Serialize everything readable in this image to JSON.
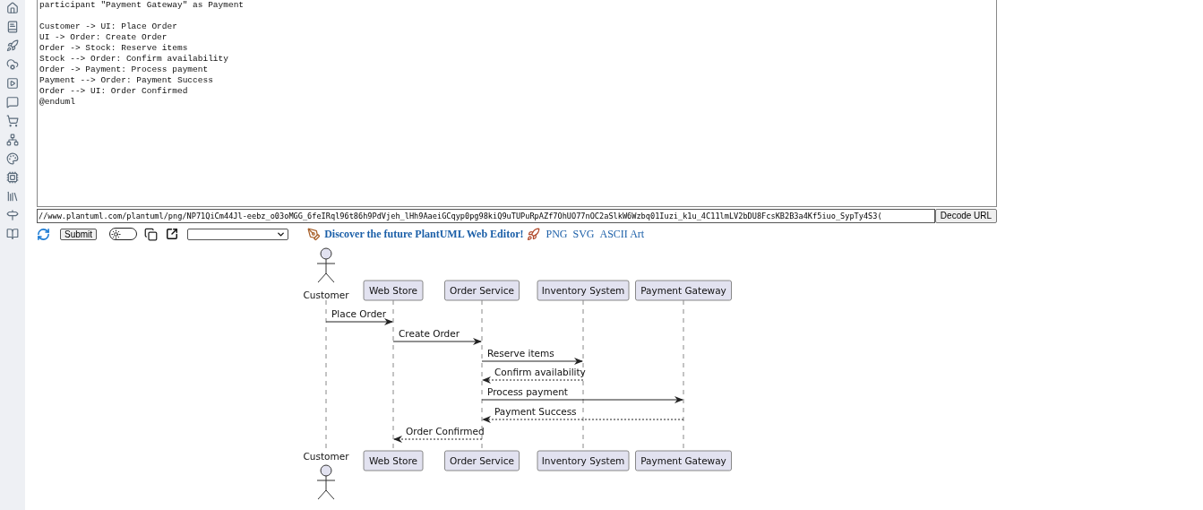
{
  "editor": {
    "header_line": "participant \"Payment Gateway\" as Payment",
    "lines": [
      "Customer -> UI: Place Order",
      "UI -> Order: Create Order",
      "Order -> Stock: Reserve items",
      "Stock --> Order: Confirm availability",
      "Order -> Payment: Process payment",
      "Payment --> Order: Payment Success",
      "Order --> UI: Order Confirmed",
      "@enduml"
    ]
  },
  "url_field": {
    "value": "//www.plantuml.com/plantuml/png/NP71QiCm44Jl-eebz_o03oMGG_6feIRql96t86h9PdVjeh_lHh9AaeiGCqyp0pg98kiQ9uTUPuRpAZf7OhUO77nOC2aSlkW6Wzbq01Iuzi_k1u_4C11lmLV2bDU8FcsKB2B3a4Kf5iuo_SypTy4S3("
  },
  "decode_button": "Decode URL",
  "toolbar": {
    "submit": "Submit",
    "theme_toggle": {
      "on": false
    },
    "editor_link": "Discover the future PlantUML Web Editor!",
    "formats": [
      "PNG",
      "SVG",
      "ASCII Art"
    ]
  },
  "diagram": {
    "participants_top": [
      {
        "name": "Customer",
        "kind": "actor"
      },
      {
        "name": "Web Store",
        "kind": "participant"
      },
      {
        "name": "Order Service",
        "kind": "participant"
      },
      {
        "name": "Inventory System",
        "kind": "participant"
      },
      {
        "name": "Payment Gateway",
        "kind": "participant"
      }
    ],
    "messages": [
      {
        "label": "Place Order",
        "kind": "sync"
      },
      {
        "label": "Create Order",
        "kind": "sync"
      },
      {
        "label": "Reserve items",
        "kind": "sync"
      },
      {
        "label": "Confirm availability",
        "kind": "return"
      },
      {
        "label": "Process payment",
        "kind": "sync"
      },
      {
        "label": "Payment Success",
        "kind": "return"
      },
      {
        "label": "Order Confirmed",
        "kind": "return"
      }
    ],
    "participants_bottom": [
      {
        "name": "Customer",
        "kind": "actor"
      },
      {
        "name": "Web Store",
        "kind": "participant"
      },
      {
        "name": "Order Service",
        "kind": "participant"
      },
      {
        "name": "Inventory System",
        "kind": "participant"
      },
      {
        "name": "Payment Gateway",
        "kind": "participant"
      }
    ]
  }
}
